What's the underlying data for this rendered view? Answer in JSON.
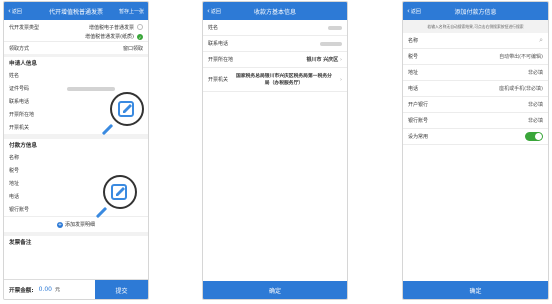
{
  "phone1": {
    "back": "返回",
    "title": "代开增值税普通发票",
    "right": "暂存上一张",
    "invoice_type_label": "代开发票类型",
    "invoice_type_options": [
      "增值税电子普通发票",
      "增值税普通发票(纸质)"
    ],
    "pickup_label": "领取方式",
    "pickup_value": "窗口领取",
    "applicant_section": "申请人信息",
    "applicant_fields": [
      "姓名",
      "证件号码",
      "联系电话",
      "开票所在地",
      "开票机关"
    ],
    "payer_section": "付款方信息",
    "payer_fields": [
      "名称",
      "税号",
      "地址",
      "电话",
      "银行账号"
    ],
    "add_detail": "添加发票明细",
    "remark_section": "发票备注",
    "amount_label": "开票金额:",
    "amount_value": "0.00",
    "amount_unit": "元",
    "submit": "提交"
  },
  "phone2": {
    "back": "返回",
    "title": "收款方基本信息",
    "name_label": "姓名",
    "phone_label": "联系电话",
    "location_label": "开票所在地",
    "location_value": "银川市 兴庆区",
    "authority_label": "开票机关",
    "authority_value": "国家税务总局银川市兴庆区税务局第一税务分局（办税服务厅）",
    "confirm": "确定"
  },
  "phone3": {
    "back": "返回",
    "title": "添加付款方信息",
    "notice": "若输入名称无自动搜索结果,可点击右侧搜索按钮进行搜索",
    "name_label": "名称",
    "tax_label": "税号",
    "tax_placeholder": "自动带出(不可编辑)",
    "address_label": "地址",
    "address_placeholder": "非必填",
    "phone_label": "电话",
    "phone_placeholder": "座机或手机(非必填)",
    "bank_label": "开户银行",
    "bank_placeholder": "非必填",
    "account_label": "银行账号",
    "account_placeholder": "非必填",
    "default_label": "设为常用",
    "confirm": "确定"
  },
  "colors": {
    "header": "#2d7ad6",
    "toggle": "#3aa63a",
    "magnifier": "#3a8ae0"
  }
}
